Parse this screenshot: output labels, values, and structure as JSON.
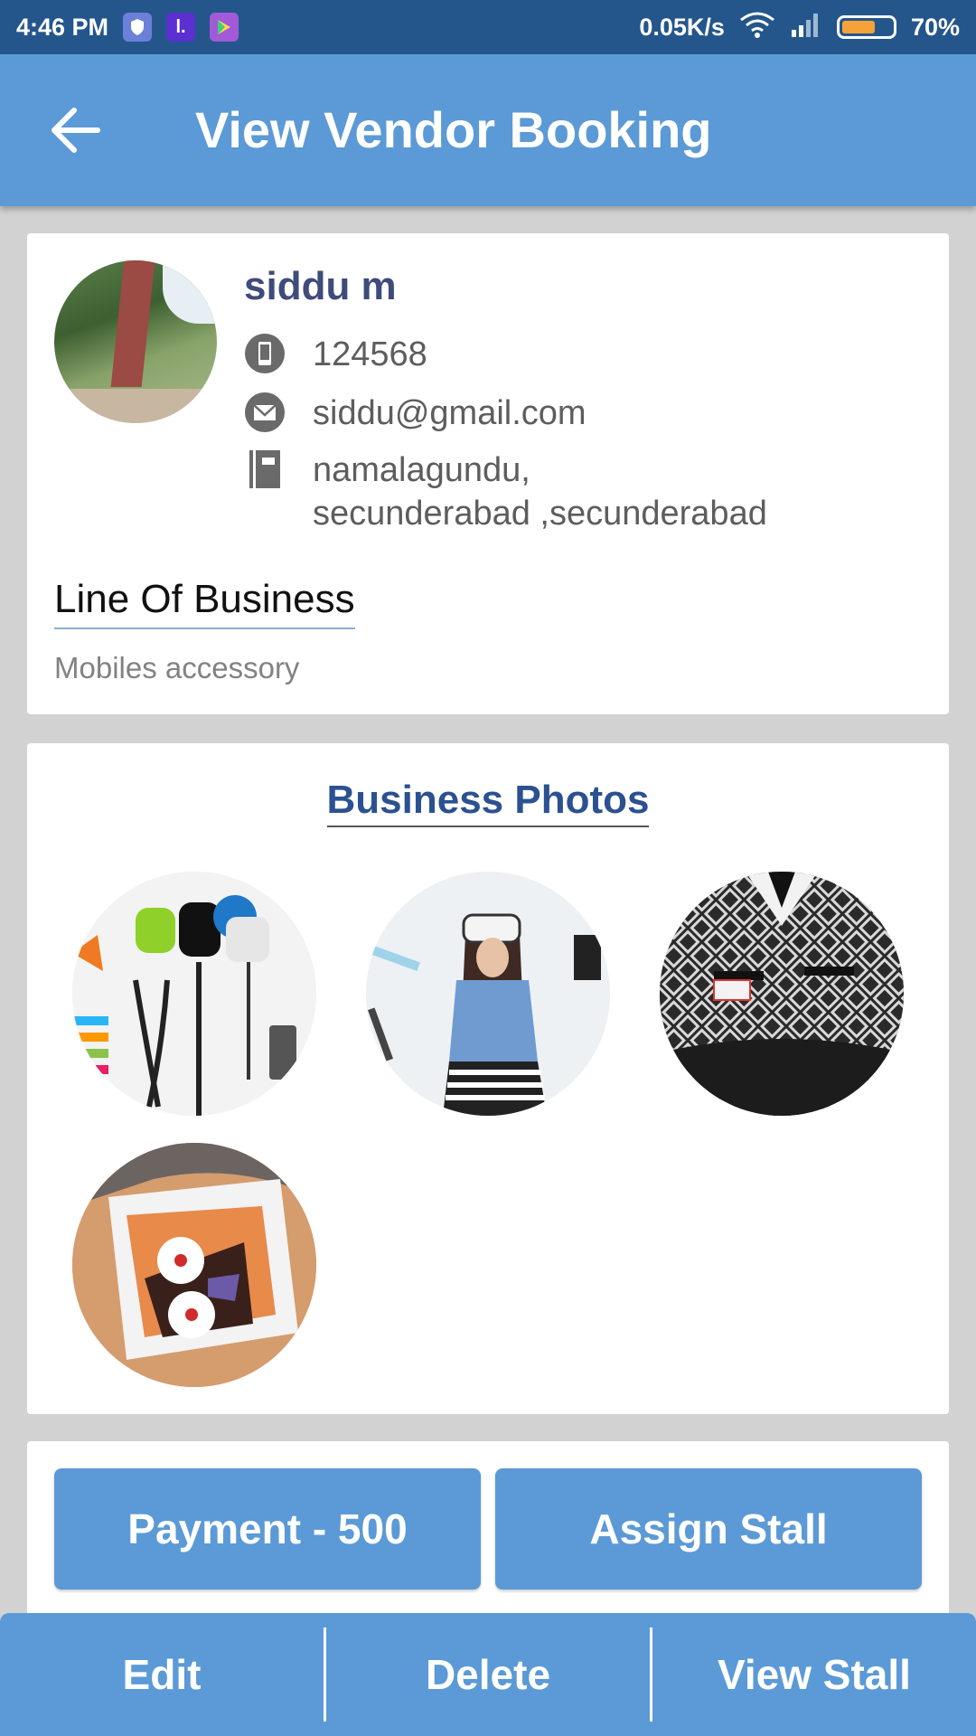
{
  "status_bar": {
    "time": "4:46 PM",
    "network_speed": "0.05K/s",
    "battery_percent": "70%",
    "battery_level": 0.7,
    "icons": [
      "shield-app-icon",
      "l-app-icon",
      "play-store-icon",
      "wifi-icon",
      "signal-icon",
      "battery-icon"
    ]
  },
  "app_bar": {
    "title": "View Vendor Booking",
    "back_icon": "arrow-left-icon"
  },
  "profile": {
    "name": "siddu m",
    "phone": "124568",
    "email": "siddu@gmail.com",
    "address_line1": "namalagundu,",
    "address_line2": "secunderabad ,secunderabad",
    "line_of_business_label": "Line Of Business",
    "line_of_business_value": "Mobiles accessory"
  },
  "photos": {
    "title": "Business Photos",
    "items": [
      "mobile-accessories-photo",
      "vr-headset-photo",
      "jacket-photo",
      "cake-photo"
    ]
  },
  "actions": {
    "payment_label": "Payment - 500",
    "assign_stall_label": "Assign Stall"
  },
  "bottom_bar": {
    "edit_label": "Edit",
    "delete_label": "Delete",
    "view_stall_label": "View Stall"
  },
  "colors": {
    "primary": "#5b9ad6",
    "status_bar": "#24568c",
    "name_text": "#3f4b7a",
    "section_title": "#2c5191"
  }
}
